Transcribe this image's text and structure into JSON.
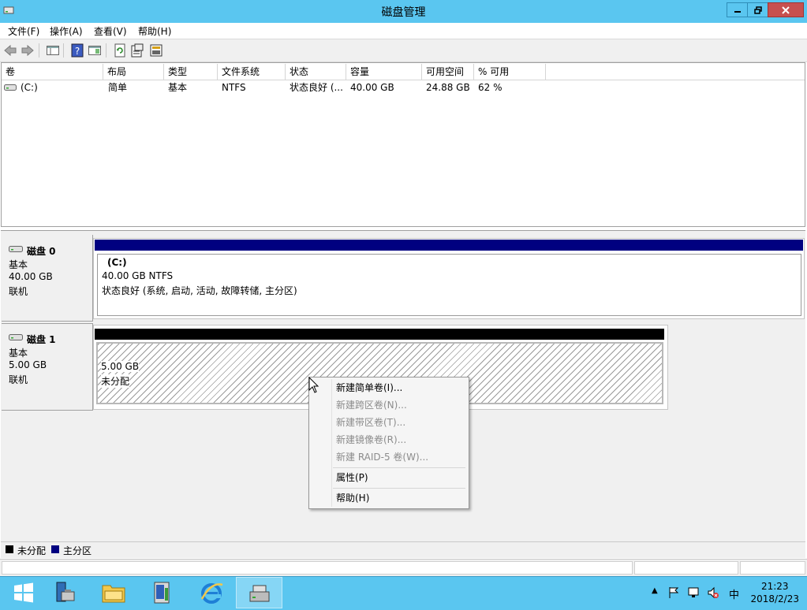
{
  "window": {
    "title": "磁盘管理"
  },
  "menu": [
    "文件(F)",
    "操作(A)",
    "查看(V)",
    "帮助(H)"
  ],
  "toolbar_icons": [
    "back-arrow-icon",
    "forward-arrow-icon",
    "console-tree-icon",
    "help-icon",
    "show-hide-icon",
    "refresh-icon",
    "properties-icon",
    "rescan-disks-icon"
  ],
  "volume_list": {
    "columns": [
      "卷",
      "布局",
      "类型",
      "文件系统",
      "状态",
      "容量",
      "可用空间",
      "% 可用"
    ],
    "rows": [
      {
        "volume": "(C:)",
        "layout": "简单",
        "type": "基本",
        "fs": "NTFS",
        "status": "状态良好 (...",
        "capacity": "40.00 GB",
        "free": "24.88 GB",
        "pct": "62 %"
      }
    ]
  },
  "disks": [
    {
      "name": "磁盘 0",
      "type": "基本",
      "size": "40.00 GB",
      "state": "联机",
      "partition": {
        "name": "(C:)",
        "size_fs": "40.00 GB NTFS",
        "status": "状态良好 (系统, 启动, 活动, 故障转储, 主分区)"
      }
    },
    {
      "name": "磁盘 1",
      "type": "基本",
      "size": "5.00 GB",
      "state": "联机",
      "partition": {
        "size": "5.00 GB",
        "status": "未分配"
      }
    }
  ],
  "context_menu": {
    "items": [
      {
        "label": "新建简单卷(I)...",
        "enabled": true
      },
      {
        "label": "新建跨区卷(N)...",
        "enabled": false
      },
      {
        "label": "新建带区卷(T)...",
        "enabled": false
      },
      {
        "label": "新建镜像卷(R)...",
        "enabled": false
      },
      {
        "label": "新建 RAID-5 卷(W)...",
        "enabled": false
      },
      {
        "label": "属性(P)",
        "enabled": true
      },
      {
        "label": "帮助(H)",
        "enabled": true
      }
    ]
  },
  "legend": [
    {
      "label": "未分配",
      "color": "#000000"
    },
    {
      "label": "主分区",
      "color": "#000080"
    }
  ],
  "colors": {
    "titlebar": "#5ac6f0",
    "primary_partition": "#000080",
    "unallocated": "#000000",
    "close_button": "#c7504f"
  },
  "taskbar": {
    "apps": [
      "start-icon",
      "server-manager-icon",
      "file-explorer-icon",
      "powershell-icon",
      "internet-explorer-icon",
      "disk-management-icon"
    ],
    "tray_icons": [
      "show-hidden-icon",
      "flag-icon",
      "network-icon",
      "volume-muted-icon"
    ],
    "ime": "中",
    "time": "21:23",
    "date": "2018/2/23"
  }
}
